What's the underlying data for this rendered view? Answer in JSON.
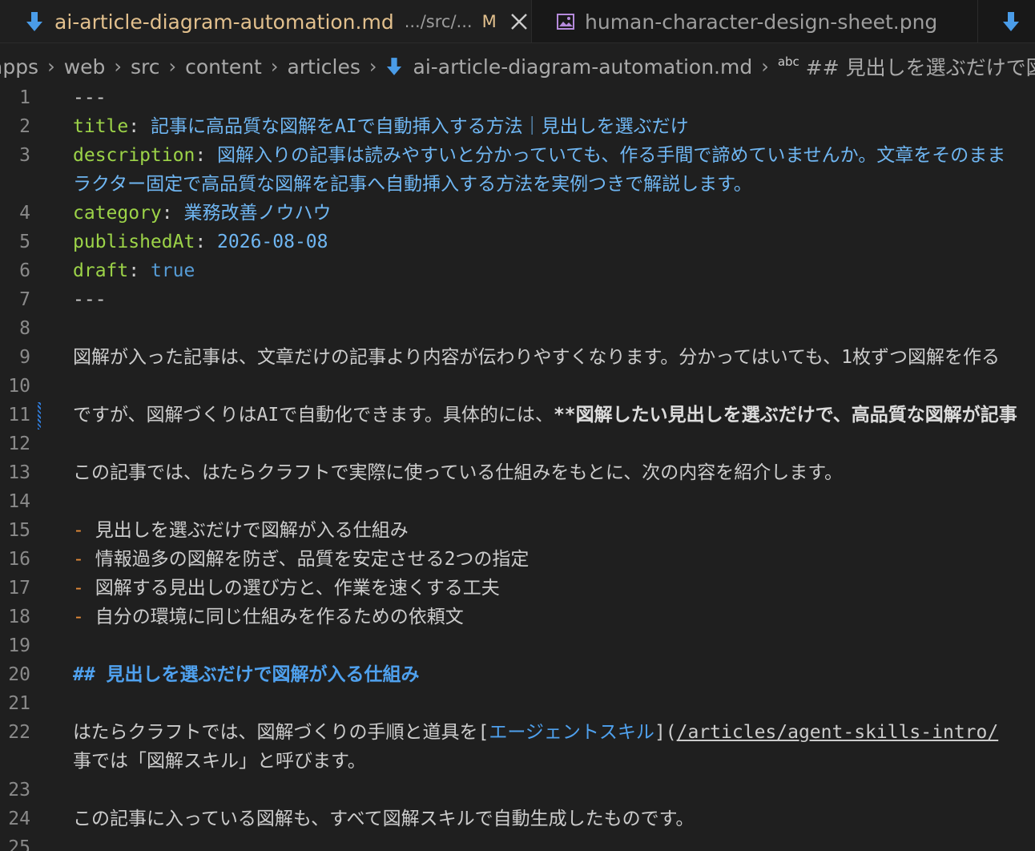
{
  "tabs": [
    {
      "title": "ai-article-diagram-automation.md",
      "path": ".../src/...",
      "modified": "M",
      "icon": "markdown-icon",
      "active": true
    },
    {
      "title": "human-character-design-sheet.png",
      "icon": "image-icon",
      "active": false
    },
    {
      "icon": "markdown-icon",
      "active": false
    }
  ],
  "breadcrumb": {
    "items": [
      "apps",
      "web",
      "src",
      "content",
      "articles",
      "ai-article-diagram-automation.md"
    ],
    "symbol_badge": "abc",
    "symbol": "## 見出しを選ぶだけで図"
  },
  "editor": {
    "lines": [
      {
        "n": "1",
        "text": "---"
      },
      {
        "n": "2",
        "key": "title",
        "value": "記事に高品質な図解をAIで自動挿入する方法｜見出しを選ぶだけ"
      },
      {
        "n": "3",
        "key": "description",
        "value": "図解入りの記事は読みやすいと分かっていても、作る手間で諦めていませんか。文章をそのまま",
        "wrap": "ラクター固定で高品質な図解を記事へ自動挿入する方法を実例つきで解説します。"
      },
      {
        "n": "4",
        "key": "category",
        "value": "業務改善ノウハウ"
      },
      {
        "n": "5",
        "key": "publishedAt",
        "value": "2026-08-08"
      },
      {
        "n": "6",
        "key": "draft",
        "value": "true"
      },
      {
        "n": "7",
        "text": "---"
      },
      {
        "n": "8",
        "text": ""
      },
      {
        "n": "9",
        "text": "図解が入った記事は、文章だけの記事より内容が伝わりやすくなります。分かってはいても、1枚ずつ図解を作る"
      },
      {
        "n": "10",
        "text": ""
      },
      {
        "n": "11",
        "text": "ですが、図解づくりはAIで自動化できます。具体的には、",
        "bold": "**図解したい見出しを選ぶだけで、高品質な図解が記事"
      },
      {
        "n": "12",
        "text": ""
      },
      {
        "n": "13",
        "text": "この記事では、はたらクラフトで実際に使っている仕組みをもとに、次の内容を紹介します。"
      },
      {
        "n": "14",
        "text": ""
      },
      {
        "n": "15",
        "bullet": "-",
        "text": "見出しを選ぶだけで図解が入る仕組み"
      },
      {
        "n": "16",
        "bullet": "-",
        "text": "情報過多の図解を防ぎ、品質を安定させる2つの指定"
      },
      {
        "n": "17",
        "bullet": "-",
        "text": "図解する見出しの選び方と、作業を速くする工夫"
      },
      {
        "n": "18",
        "bullet": "-",
        "text": "自分の環境に同じ仕組みを作るための依頼文"
      },
      {
        "n": "19",
        "text": ""
      },
      {
        "n": "20",
        "heading": "## 見出しを選ぶだけで図解が入る仕組み"
      },
      {
        "n": "21",
        "text": ""
      },
      {
        "n": "22",
        "text": "はたらクラフトでは、図解づくりの手順と道具を[",
        "link_text": "エージェントスキル",
        "mid": "](",
        "url": "/articles/agent-skills-intro/",
        "wrap": "事では「図解スキル」と呼びます。"
      },
      {
        "n": "23",
        "text": ""
      },
      {
        "n": "24",
        "text": "この記事に入っている図解も、すべて図解スキルで自動生成したものです。"
      },
      {
        "n": "25",
        "text": ""
      }
    ]
  }
}
